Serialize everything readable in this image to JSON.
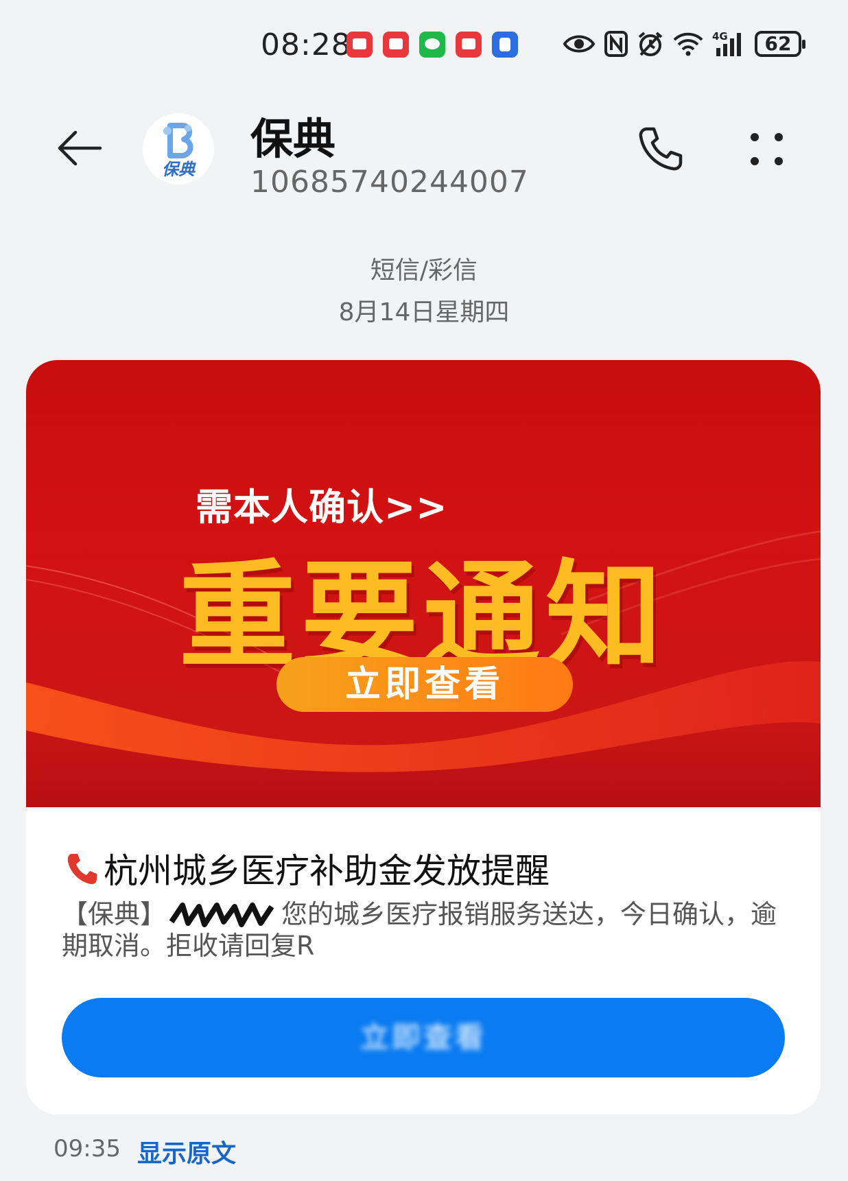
{
  "status_bar": {
    "time": "08:28",
    "notification_icons": [
      "red-app-icon",
      "red-app-icon",
      "wechat-icon",
      "red-app-icon",
      "blue-app-icon"
    ],
    "system_icons": [
      "eye-icon",
      "nfc-icon",
      "alarm-icon",
      "wifi-icon",
      "signal-4g-icon"
    ],
    "network_label": "4G",
    "battery_level": "62"
  },
  "header": {
    "back_icon": "arrow-left-icon",
    "avatar_text": "保典",
    "contact_name": "保典",
    "contact_number": "10685740244007",
    "call_icon": "phone-icon",
    "more_icon": "more-dots-icon"
  },
  "thread": {
    "message_type": "短信/彩信",
    "date": "8月14日星期四"
  },
  "card": {
    "banner": {
      "subtitle": "需本人确认>>",
      "title": "重要通知",
      "button_label": "立即查看"
    },
    "title_icon": "telephone-receiver-icon",
    "title": "杭州城乡医疗补助金发放提醒",
    "body_prefix": "【保典】",
    "body_text": "您的城乡医疗报销服务送达，今日确认，逾期取消。拒收请回复R",
    "cta_label": "立即查看"
  },
  "footer": {
    "time": "09:35",
    "show_original": "显示原文"
  },
  "colors": {
    "background": "#f1f3f5",
    "banner_red": "#d31212",
    "banner_gold": "#fdbc22",
    "banner_button_orange": "#ff7a14",
    "cta_blue": "#0a7bf0",
    "link_blue": "#1766c8"
  }
}
